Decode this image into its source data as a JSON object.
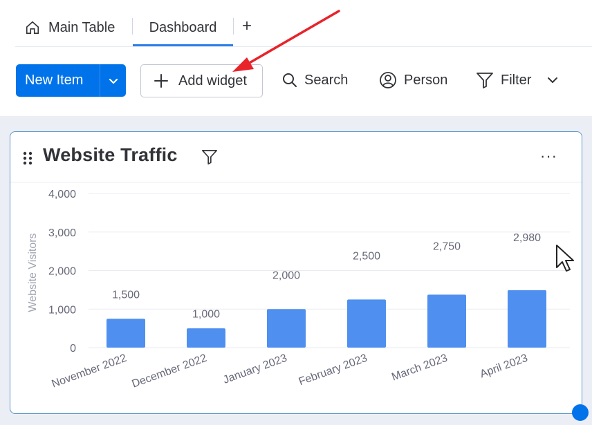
{
  "tabs": {
    "main_table": "Main Table",
    "dashboard": "Dashboard",
    "add": "+"
  },
  "toolbar": {
    "new_item": "New Item",
    "add_widget": "Add widget",
    "search": "Search",
    "person": "Person",
    "filter": "Filter"
  },
  "widget": {
    "title": "Website Traffic",
    "menu": "···"
  },
  "colors": {
    "accent": "#0073ea",
    "bar": "#4f8ff0",
    "annotation_arrow": "#e8232a"
  },
  "chart_data": {
    "type": "bar",
    "categories": [
      "November 2022",
      "December 2022",
      "January 2023",
      "February 2023",
      "March 2023",
      "April 2023"
    ],
    "values": [
      1500,
      1000,
      2000,
      2500,
      2750,
      2980
    ],
    "data_labels": [
      "1,500",
      "1,000",
      "2,000",
      "2,500",
      "2,750",
      "2,980"
    ],
    "ylabel": "Website Visitors",
    "yticks": [
      "0",
      "1,000",
      "2,000",
      "3,000",
      "4,000"
    ],
    "ylim": [
      0,
      4000
    ],
    "grid": true
  }
}
